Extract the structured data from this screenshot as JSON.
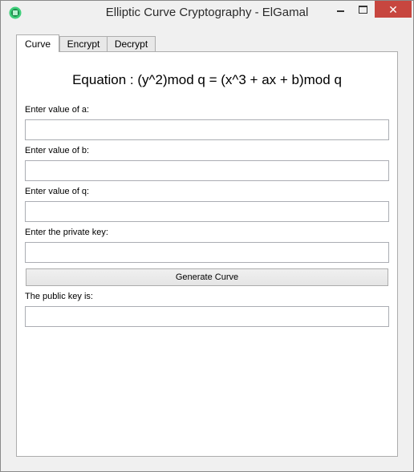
{
  "window": {
    "title": "Elliptic Curve Cryptography - ElGamal",
    "close_glyph": "✕"
  },
  "tabs": [
    {
      "label": "Curve",
      "active": true
    },
    {
      "label": "Encrypt",
      "active": false
    },
    {
      "label": "Decrypt",
      "active": false
    }
  ],
  "curve": {
    "equation": "Equation : (y^2)mod q = (x^3 + ax + b)mod q",
    "fields": [
      {
        "label": "Enter value of a:",
        "value": ""
      },
      {
        "label": "Enter value of b:",
        "value": ""
      },
      {
        "label": "Enter value of q:",
        "value": ""
      },
      {
        "label": "Enter the private key:",
        "value": ""
      }
    ],
    "generate_button": "Generate Curve",
    "public_key": {
      "label": "The public key is:",
      "value": ""
    }
  },
  "colors": {
    "close_button": "#c7463f",
    "app_icon": "#3ecf7a"
  },
  "icons": {
    "app": "app-icon",
    "minimize": "minimize-icon",
    "maximize": "maximize-icon",
    "close": "close-icon"
  }
}
